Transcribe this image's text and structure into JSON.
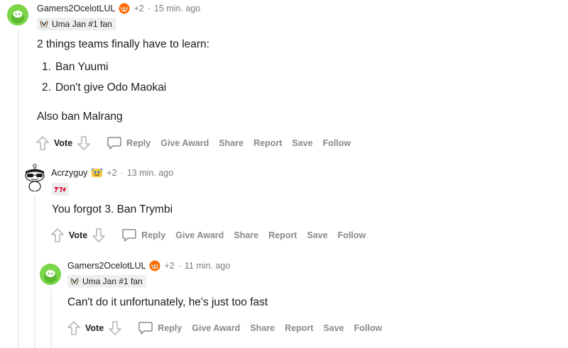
{
  "comments": [
    {
      "username": "Gamers2OcelotLUL",
      "score": "+2",
      "separator": "·",
      "time": "15 min. ago",
      "flair": "Uma Jan #1 fan",
      "paragraphs": [
        "2 things teams finally have to learn:",
        "Also ban Malrang"
      ],
      "list": [
        "Ban Yuumi",
        "Don't give Odo Maokai"
      ],
      "list_numbers": [
        "1.",
        "2."
      ]
    },
    {
      "username": "Acrzyguy",
      "score": "+2",
      "separator": "·",
      "time": "13 min. ago",
      "paragraphs": [
        "You forgot 3. Ban Trymbi"
      ]
    },
    {
      "username": "Gamers2OcelotLUL",
      "score": "+2",
      "separator": "·",
      "time": "11 min. ago",
      "flair": "Uma Jan #1 fan",
      "paragraphs": [
        "Can't do it unfortunately, he's just too fast"
      ]
    }
  ],
  "actions": {
    "vote": "Vote",
    "reply": "Reply",
    "give_award": "Give Award",
    "share": "Share",
    "report": "Report",
    "save": "Save",
    "follow": "Follow"
  },
  "icons": {
    "avatar": "snoo-avatar-icon",
    "upvote": "arrow-up-icon",
    "downvote": "arrow-down-icon",
    "reply": "speech-bubble-icon",
    "user_badge": "fox-badge-icon",
    "flair": "laurel-icon",
    "team_flair": "t1-logo-icon"
  },
  "colors": {
    "green_avatar": "#7bd64a",
    "muted": "#878a8c",
    "t1_red": "#e2012d"
  }
}
